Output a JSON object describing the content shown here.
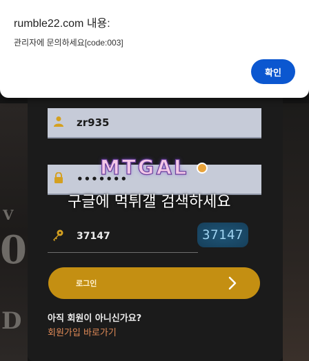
{
  "dialog": {
    "title": "rumble22.com 내용:",
    "message": "관리자에 문의하세요[code:003]",
    "ok_label": "확인"
  },
  "login": {
    "username_value": "zr935",
    "password_value": "•••••••",
    "captcha_input_value": "37147",
    "captcha_image_text": "37147",
    "login_label": "로그인",
    "no_member_text": "아직 회원이 아니신가요?",
    "join_link_text": "회원가입 바로가기"
  },
  "logo_text": "MTGAL",
  "watermark_text": "구글에 먹튀갤 검색하세요",
  "background_glyphs": [
    "V",
    "0",
    "D"
  ],
  "colors": {
    "accent": "#c48f12",
    "icon_gold": "#d4a020",
    "dialog_button": "#0b57d0",
    "link": "#e08a57",
    "field_bg": "#c6cbd8"
  },
  "icons": {
    "user": "user-icon",
    "lock": "lock-icon",
    "key": "key-icon",
    "arrow": "chevron-right-icon"
  }
}
